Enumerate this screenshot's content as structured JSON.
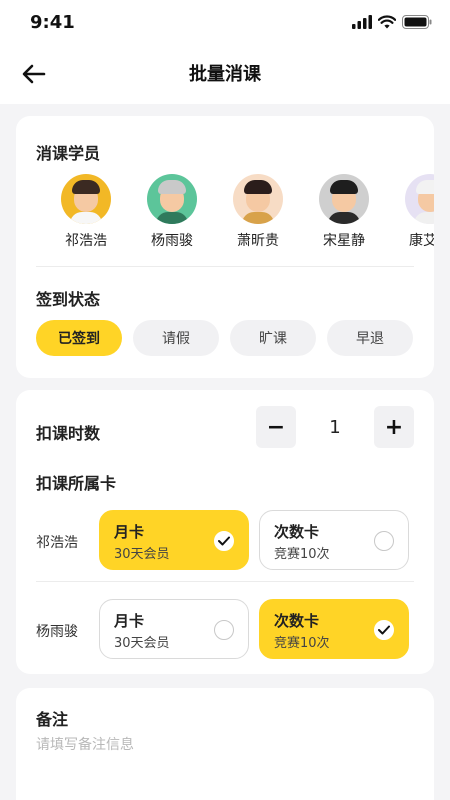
{
  "status_bar": {
    "time": "9:41"
  },
  "nav": {
    "title": "批量消课"
  },
  "students_section": {
    "title": "消课学员",
    "students": [
      {
        "name": "祁浩浩",
        "bg": "#f2b826",
        "hair": "#3b2a22",
        "shirt": "#f7f7f7"
      },
      {
        "name": "杨雨骏",
        "bg": "#5cc59a",
        "hair": "#c9c9c9",
        "shirt": "#2f7a5c"
      },
      {
        "name": "萧昕贵",
        "bg": "#f7dcc5",
        "hair": "#2b1d1b",
        "shirt": "#d8a24a"
      },
      {
        "name": "宋星静",
        "bg": "#cfcfcf",
        "hair": "#1e1e1e",
        "shirt": "#2a2a2a"
      },
      {
        "name": "康艾宸",
        "bg": "#e6e1f3",
        "hair": "#f2f2f2",
        "shirt": "#f0f0f0"
      }
    ]
  },
  "checkin": {
    "title": "签到状态",
    "options": [
      {
        "label": "已签到",
        "active": true
      },
      {
        "label": "请假",
        "active": false
      },
      {
        "label": "旷课",
        "active": false
      },
      {
        "label": "早退",
        "active": false
      }
    ]
  },
  "deduct": {
    "hours_label": "扣课时数",
    "hours_value": "1",
    "minus": "−",
    "plus": "+",
    "cards_label": "扣课所属卡",
    "rows": [
      {
        "student": "祁浩浩",
        "cards": [
          {
            "title": "月卡",
            "subtitle": "30天会员",
            "selected": true
          },
          {
            "title": "次数卡",
            "subtitle": "竞赛10次",
            "selected": false
          }
        ]
      },
      {
        "student": "杨雨骏",
        "cards": [
          {
            "title": "月卡",
            "subtitle": "30天会员",
            "selected": false
          },
          {
            "title": "次数卡",
            "subtitle": "竞赛10次",
            "selected": true
          }
        ]
      }
    ]
  },
  "remark": {
    "title": "备注",
    "placeholder": "请填写备注信息"
  },
  "colors": {
    "accent": "#ffd426",
    "background": "#f4f4f6"
  }
}
